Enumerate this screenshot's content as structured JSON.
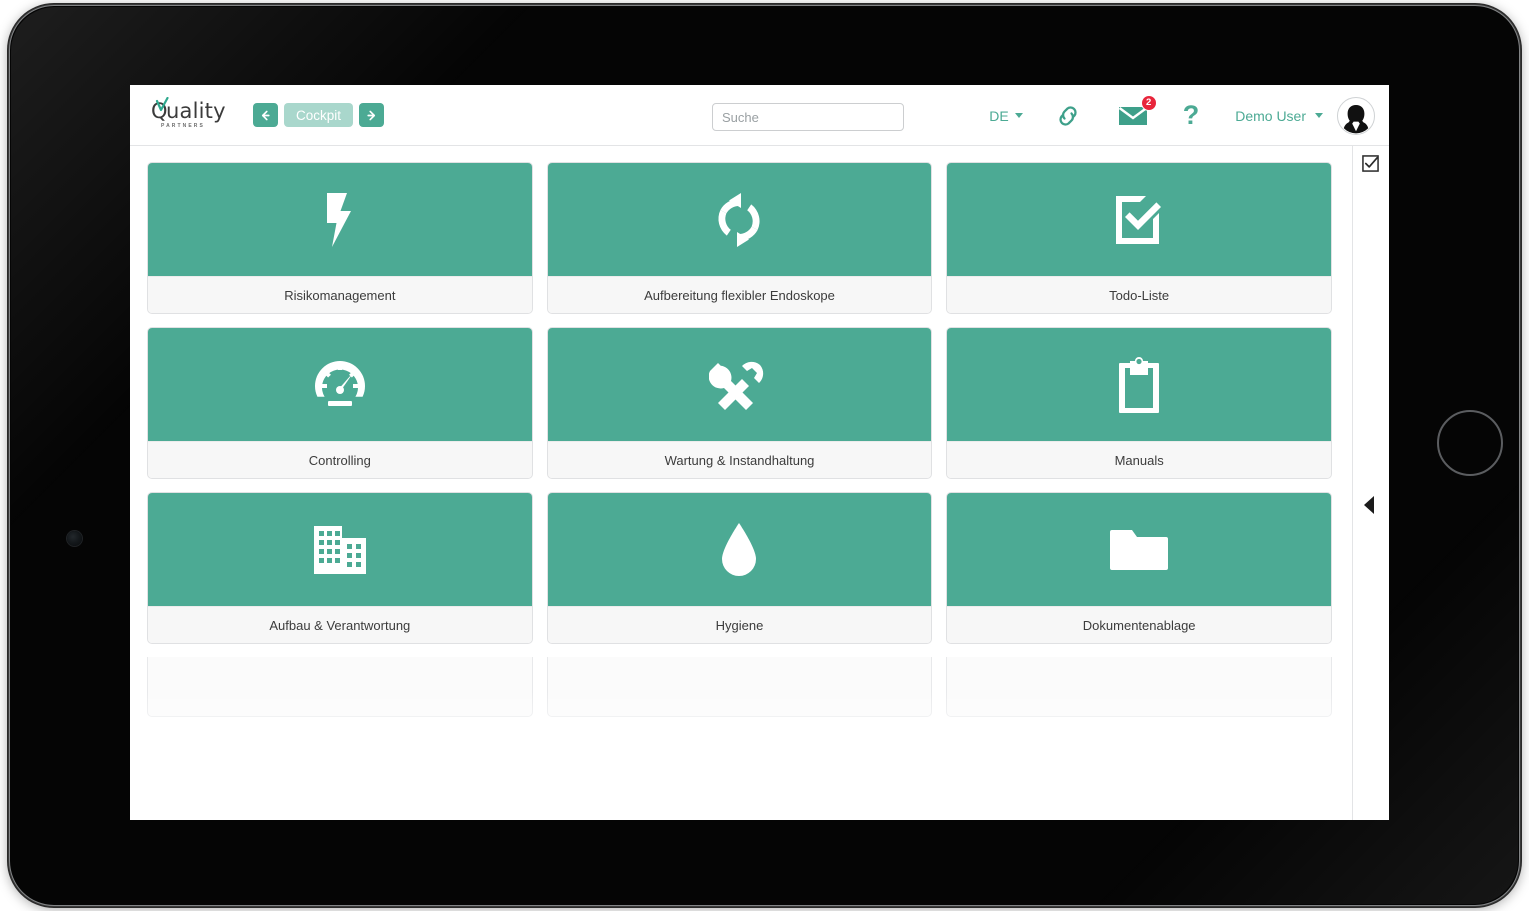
{
  "brand": {
    "name": "Quality",
    "subtitle": "PARTNERS",
    "accent_color": "#4caa94",
    "accent_muted": "#a9d7cc",
    "badge_color": "#e8253b",
    "logo_check_icon": "check-mark-icon"
  },
  "topbar": {
    "nav_back_label": "←",
    "nav_back_icon": "arrow-left-icon",
    "breadcrumb_label": "Cockpit",
    "nav_forward_label": "→",
    "nav_forward_icon": "arrow-right-icon",
    "search": {
      "value": "",
      "placeholder": "Suche",
      "icon": "search-icon"
    },
    "language": {
      "label": "DE",
      "caret_icon": "chevron-down-icon"
    },
    "link_icon": "link-chain-icon",
    "mail": {
      "icon": "envelope-icon",
      "badge_count": "2"
    },
    "help": {
      "icon": "question-mark-icon",
      "label": "?"
    },
    "user": {
      "name": "Demo User",
      "caret_icon": "chevron-down-icon",
      "avatar_icon": "user-avatar-icon"
    }
  },
  "right_rail": {
    "checklist_icon": "check-square-icon",
    "collapse_icon": "triangle-left-icon"
  },
  "tiles": [
    {
      "label": "Risikomanagement",
      "icon": "lightning-bolt-icon"
    },
    {
      "label": "Aufbereitung flexibler Endoskope",
      "icon": "refresh-cycle-icon"
    },
    {
      "label": "Todo-Liste",
      "icon": "check-square-icon"
    },
    {
      "label": "Controlling",
      "icon": "tachometer-gauge-icon"
    },
    {
      "label": "Wartung & Instandhaltung",
      "icon": "tools-wrench-hammer-icon"
    },
    {
      "label": "Manuals",
      "icon": "clipboard-icon"
    },
    {
      "label": "Aufbau & Verantwortung",
      "icon": "building-icon"
    },
    {
      "label": "Hygiene",
      "icon": "water-drop-icon"
    },
    {
      "label": "Dokumentenablage",
      "icon": "folder-icon"
    }
  ]
}
